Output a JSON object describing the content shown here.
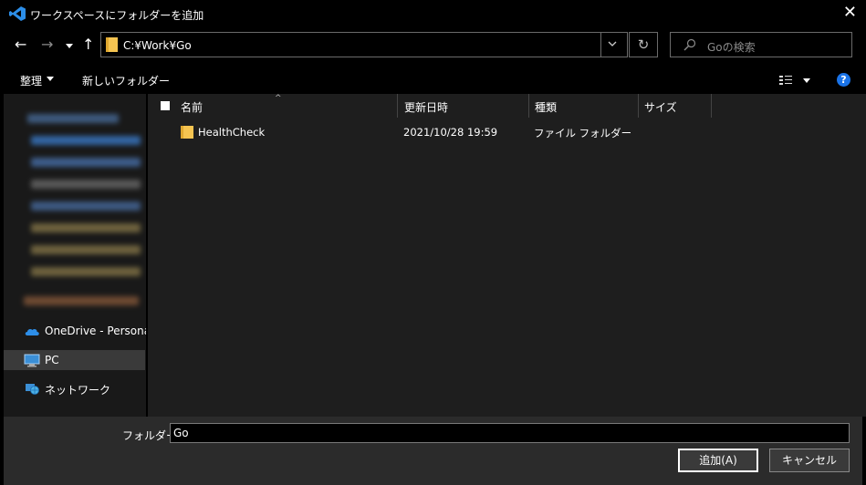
{
  "window": {
    "title": "ワークスペースにフォルダーを追加",
    "close_glyph": "✕"
  },
  "nav": {
    "back_glyph": "←",
    "forward_glyph": "→",
    "recent_glyph": "⌄",
    "up_glyph": "↑",
    "address": "C:¥Work¥Go",
    "refresh_glyph": "↻",
    "search_placeholder": "Goの検索"
  },
  "toolbar": {
    "organize": "整理",
    "new_folder": "新しいフォルダー",
    "help": "?"
  },
  "sidebar": {
    "items": [
      {
        "label": "OneDrive - Personal",
        "icon": "cloud-icon"
      },
      {
        "label": "PC",
        "icon": "pc-icon"
      },
      {
        "label": "ネットワーク",
        "icon": "network-icon"
      }
    ]
  },
  "columns": [
    {
      "label": "名前"
    },
    {
      "label": "更新日時"
    },
    {
      "label": "種類"
    },
    {
      "label": "サイズ"
    }
  ],
  "sort_glyph": "^",
  "files": [
    {
      "name": "HealthCheck",
      "modified": "2021/10/28 19:59",
      "type": "ファイル フォルダー",
      "size": ""
    }
  ],
  "footer": {
    "folder_label": "フォルダー:",
    "folder_value": "Go",
    "ok_label": "追加(A)",
    "cancel_label": "キャンセル"
  },
  "colors": {
    "folder_yellow": "#f5c451",
    "accent_blue": "#1a73e8",
    "vscode_blue": "#2c8ee8"
  }
}
